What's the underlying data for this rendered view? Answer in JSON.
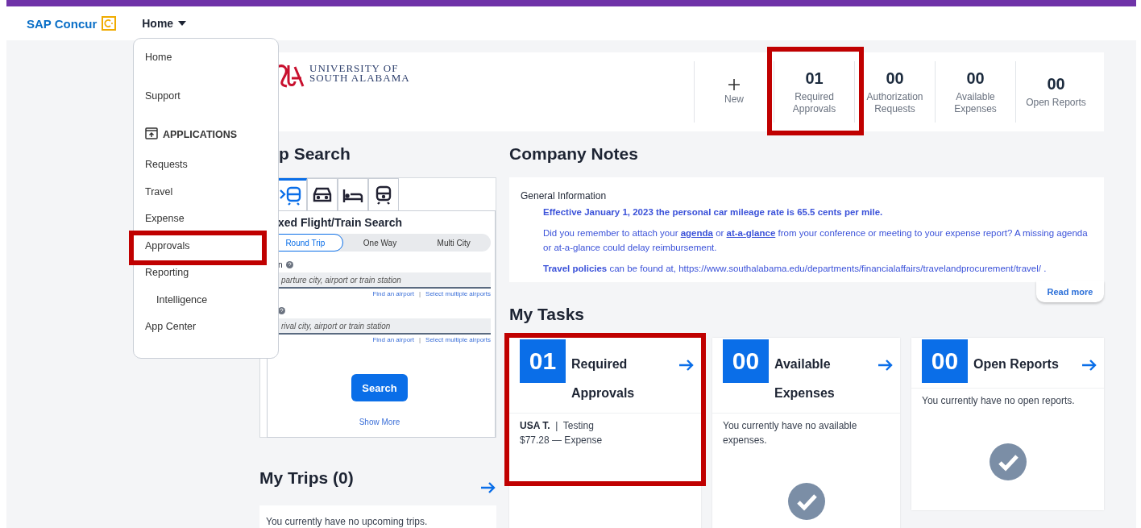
{
  "header": {
    "logo": "SAP Concur",
    "nav": {
      "label": "Home",
      "expanded": true
    }
  },
  "menu": [
    {
      "kind": "item",
      "label": "Home",
      "highlighted": false
    },
    {
      "kind": "item",
      "label": "Support",
      "highlighted": false
    },
    {
      "kind": "section",
      "label": "APPLICATIONS",
      "highlighted": false
    },
    {
      "kind": "item",
      "label": "Requests",
      "highlighted": false
    },
    {
      "kind": "item",
      "label": "Travel",
      "highlighted": false
    },
    {
      "kind": "item",
      "label": "Expense",
      "highlighted": false
    },
    {
      "kind": "item",
      "label": "Approvals",
      "highlighted": true
    },
    {
      "kind": "item",
      "label": "Reporting",
      "highlighted": false
    },
    {
      "kind": "subitem",
      "label": "Intelligence",
      "highlighted": false
    },
    {
      "kind": "item",
      "label": "App Center",
      "highlighted": false
    }
  ],
  "banner": {
    "org_lines": [
      "UNIVERSITY OF",
      "SOUTH ALABAMA"
    ],
    "new_label": "New",
    "stats": [
      {
        "count": "01",
        "label": "Required Approvals",
        "highlighted": true
      },
      {
        "count": "00",
        "label": "Authorization Requests",
        "highlighted": false
      },
      {
        "count": "00",
        "label": "Available Expenses",
        "highlighted": false
      },
      {
        "count": "00",
        "label": "Open Reports",
        "highlighted": false
      }
    ]
  },
  "trip_search": {
    "title": "p Search",
    "tabs": [
      {
        "kind": "flight-train",
        "selected": true
      },
      {
        "kind": "car",
        "selected": false
      },
      {
        "kind": "hotel",
        "selected": false
      },
      {
        "kind": "train",
        "selected": false
      }
    ],
    "form_title": "xed Flight/Train Search",
    "trip_types": [
      {
        "label": "Round Trip",
        "selected": true
      },
      {
        "label": "One Way",
        "selected": false
      },
      {
        "label": "Multi City",
        "selected": false
      }
    ],
    "fields": [
      {
        "label": "n",
        "placeholder": "parture city, airport or train station",
        "links": [
          "Find an airport",
          "Select multiple airports"
        ],
        "separator": "|"
      },
      {
        "placeholder": "rival city, airport or train station",
        "links": [
          "Find an airport",
          "Select multiple airports"
        ],
        "separator": "|"
      }
    ],
    "search_button": "Search",
    "show_more": "Show More"
  },
  "my_trips": {
    "title": "My Trips (0)",
    "empty": "You currently have no upcoming trips."
  },
  "company_notes": {
    "title": "Company Notes",
    "heading": "General Information",
    "lead": "Effective January 1, 2023 the personal car mileage rate is 65.5 cents per mile.",
    "reminder": [
      {
        "kind": "text",
        "text": "Did you remember to attach your "
      },
      {
        "kind": "link",
        "text": "agenda"
      },
      {
        "kind": "text",
        "text": " or "
      },
      {
        "kind": "link",
        "text": "at-a-glance"
      },
      {
        "kind": "text",
        "text": " from your conference or meeting to your expense report? A missing agenda or at-a-glance could delay reimbursement."
      }
    ],
    "policy": "**Travel policies** can be found at, https://www.southalabama.edu/departments/financialaffairs/travelandprocurement/travel/ .",
    "read_more": "Read more"
  },
  "my_tasks": {
    "title": "My Tasks",
    "cards": [
      {
        "count": "01",
        "title": "Required Approvals",
        "highlighted": true,
        "items": [
          {
            "name": "USA T.",
            "separator": "|",
            "detail": "Testing",
            "amount": "$77.28 — Expense"
          }
        ]
      },
      {
        "count": "00",
        "title": "Available Expenses",
        "highlighted": false,
        "empty": "You currently have no available expenses."
      },
      {
        "count": "00",
        "title": "Open Reports",
        "highlighted": false,
        "empty": "You currently have no open reports."
      }
    ]
  }
}
